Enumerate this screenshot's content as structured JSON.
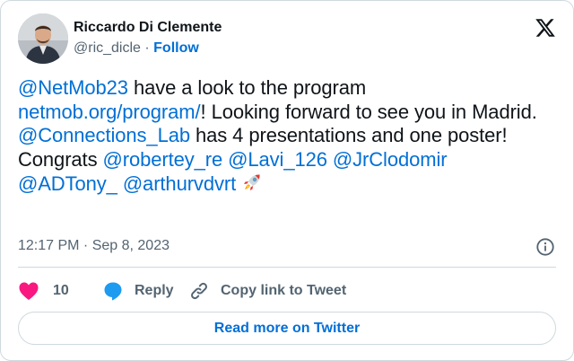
{
  "author": {
    "display_name": "Riccardo Di Clemente",
    "handle": "@ric_dicle",
    "separator": " · ",
    "follow_label": "Follow"
  },
  "tweet": {
    "mention_netmob": "@NetMob23",
    "text_1": " have a look to the program",
    "link_program": "netmob.org/program/",
    "text_2": "! Looking forward to see you in Madrid. ",
    "mention_lab": "@Connections_Lab",
    "text_3": " has 4 presentations and one poster!",
    "text_congrats": "Congrats ",
    "mention_robertey": "@robertey_re",
    "mention_lavi": "@Lavi_126",
    "mention_jr": "@JrClodomir",
    "mention_adtony": "@ADTony_",
    "mention_arthur": "@arthurvdvrt",
    "rocket_icon": "rocket-emoji"
  },
  "meta": {
    "timestamp": "12:17 PM · Sep 8, 2023"
  },
  "actions": {
    "like_count": "10",
    "reply_label": "Reply",
    "copy_label": "Copy link to Tweet"
  },
  "footer": {
    "read_more_label": "Read more on Twitter"
  },
  "colors": {
    "link_blue": "#006fd6",
    "like_pink": "#f91880",
    "reply_blue": "#1d9bf0",
    "muted_gray": "#536471",
    "border": "#cfd9de"
  }
}
